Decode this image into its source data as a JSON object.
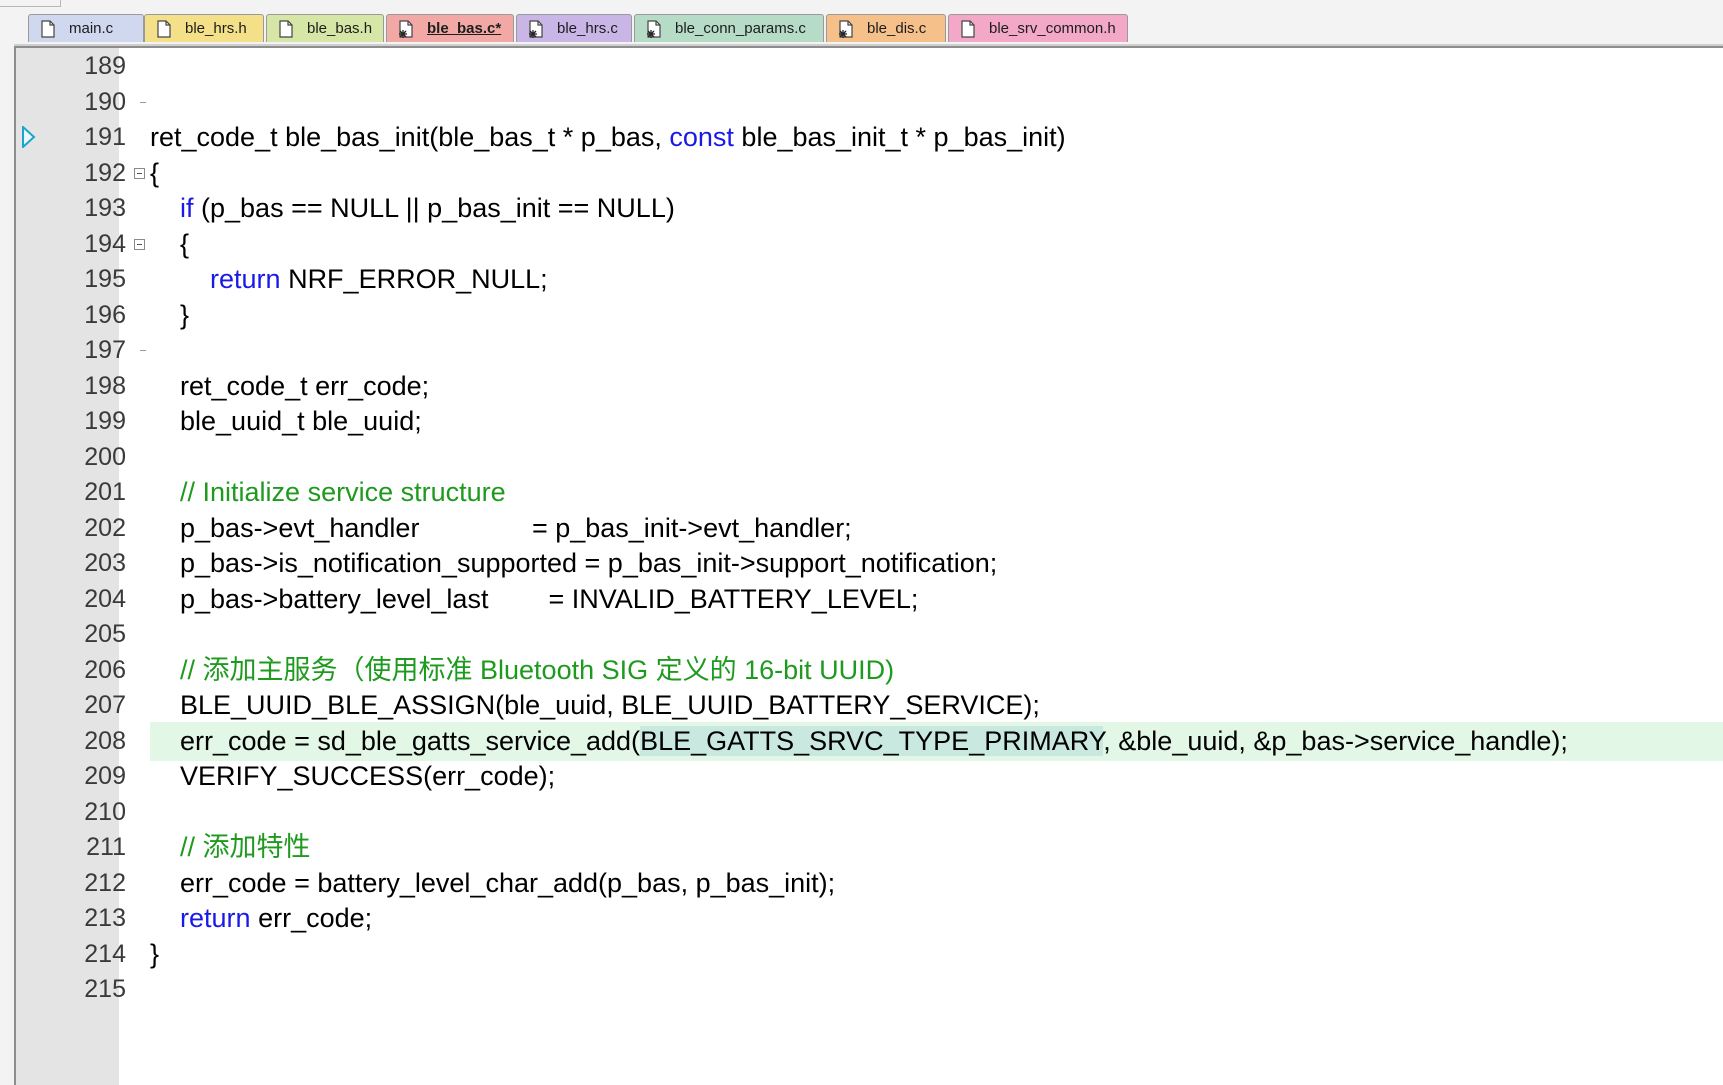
{
  "tabs": [
    {
      "label": "main.c",
      "icon": "c-file-icon",
      "color": "#cfd8ee",
      "active": false
    },
    {
      "label": "ble_hrs.h",
      "icon": "h-file-icon",
      "color": "#f5e08a",
      "active": false
    },
    {
      "label": "ble_bas.h",
      "icon": "h-file-icon",
      "color": "#d6e6a6",
      "active": false
    },
    {
      "label": "ble_bas.c*",
      "icon": "c-file-modified-icon",
      "color": "#f2a9a6",
      "active": true
    },
    {
      "label": "ble_hrs.c",
      "icon": "c-file-modified-icon",
      "color": "#c9b6e6",
      "active": false
    },
    {
      "label": "ble_conn_params.c",
      "icon": "c-file-modified-icon",
      "color": "#b6dcc8",
      "active": false
    },
    {
      "label": "ble_dis.c",
      "icon": "c-file-modified-icon",
      "color": "#f5c08a",
      "active": false
    },
    {
      "label": "ble_srv_common.h",
      "icon": "h-file-icon",
      "color": "#f2a8c6",
      "active": false
    }
  ],
  "editor": {
    "current_line": "208",
    "execution_marker_line": "191",
    "lines": [
      {
        "num": "189",
        "segs": []
      },
      {
        "num": "190",
        "segs": []
      },
      {
        "num": "191",
        "segs": [
          {
            "t": "ret_code_t ble_bas_init(ble_bas_t * p_bas, ",
            "c": "plain"
          },
          {
            "t": "const",
            "c": "keyword"
          },
          {
            "t": " ble_bas_init_t * p_bas_init)",
            "c": "plain"
          }
        ]
      },
      {
        "num": "192",
        "segs": [
          {
            "t": "{",
            "c": "plain"
          }
        ]
      },
      {
        "num": "193",
        "segs": [
          {
            "t": "    ",
            "c": "plain"
          },
          {
            "t": "if",
            "c": "keyword"
          },
          {
            "t": " (p_bas == NULL || p_bas_init == NULL)",
            "c": "plain"
          }
        ]
      },
      {
        "num": "194",
        "segs": [
          {
            "t": "    {",
            "c": "plain"
          }
        ]
      },
      {
        "num": "195",
        "segs": [
          {
            "t": "        ",
            "c": "plain"
          },
          {
            "t": "return",
            "c": "keyword"
          },
          {
            "t": " NRF_ERROR_NULL;",
            "c": "plain"
          }
        ]
      },
      {
        "num": "196",
        "segs": [
          {
            "t": "    }",
            "c": "plain"
          }
        ]
      },
      {
        "num": "197",
        "segs": []
      },
      {
        "num": "198",
        "segs": [
          {
            "t": "    ret_code_t err_code;",
            "c": "plain"
          }
        ]
      },
      {
        "num": "199",
        "segs": [
          {
            "t": "    ble_uuid_t ble_uuid;",
            "c": "plain"
          }
        ]
      },
      {
        "num": "200",
        "segs": []
      },
      {
        "num": "201",
        "segs": [
          {
            "t": "    ",
            "c": "plain"
          },
          {
            "t": "// Initialize service structure",
            "c": "comment"
          }
        ]
      },
      {
        "num": "202",
        "segs": [
          {
            "t": "    p_bas->evt_handler               = p_bas_init->evt_handler;",
            "c": "plain"
          }
        ]
      },
      {
        "num": "203",
        "segs": [
          {
            "t": "    p_bas->is_notification_supported = p_bas_init->support_notification;",
            "c": "plain"
          }
        ]
      },
      {
        "num": "204",
        "segs": [
          {
            "t": "    p_bas->battery_level_last        = INVALID_BATTERY_LEVEL;",
            "c": "plain"
          }
        ]
      },
      {
        "num": "205",
        "segs": []
      },
      {
        "num": "206",
        "segs": [
          {
            "t": "    ",
            "c": "plain"
          },
          {
            "t": "// 添加主服务（使用标准 Bluetooth SIG 定义的 16-bit UUID)",
            "c": "comment"
          }
        ]
      },
      {
        "num": "207",
        "segs": [
          {
            "t": "    BLE_UUID_BLE_ASSIGN(ble_uuid, BLE_UUID_BATTERY_SERVICE);",
            "c": "plain"
          }
        ]
      },
      {
        "num": "208",
        "segs": [
          {
            "t": "    err_code = sd_ble_gatts_service_add(",
            "c": "plain"
          },
          {
            "t": "BLE_GATTS_SRVC_TYPE",
            "c": "selected"
          },
          {
            "t": "|",
            "c": "caret"
          },
          {
            "t": "_PRIMARY",
            "c": "selected"
          },
          {
            "t": ", &ble_uuid, &p_bas->service_handle);",
            "c": "plain"
          }
        ]
      },
      {
        "num": "209",
        "segs": [
          {
            "t": "    VERIFY_SUCCESS(err_code);",
            "c": "plain"
          }
        ]
      },
      {
        "num": "210",
        "segs": []
      },
      {
        "num": "211",
        "segs": [
          {
            "t": "    ",
            "c": "plain"
          },
          {
            "t": "// 添加特性",
            "c": "comment"
          }
        ]
      },
      {
        "num": "212",
        "segs": [
          {
            "t": "    err_code = battery_level_char_add(p_bas, p_bas_init);",
            "c": "plain"
          }
        ]
      },
      {
        "num": "213",
        "segs": [
          {
            "t": "    ",
            "c": "plain"
          },
          {
            "t": "return",
            "c": "keyword"
          },
          {
            "t": " err_code;",
            "c": "plain"
          }
        ]
      },
      {
        "num": "214",
        "segs": [
          {
            "t": "}",
            "c": "plain"
          }
        ]
      },
      {
        "num": "215",
        "segs": []
      }
    ]
  },
  "colors": {
    "keyword": "#1a1ae6",
    "comment": "#1e9a1e",
    "current_line_bg": "#e2f7e6",
    "selection_bg": "#c8e8e0",
    "gutter_bg": "#e4e4e4",
    "execution_marker": "#1aa6c8"
  }
}
